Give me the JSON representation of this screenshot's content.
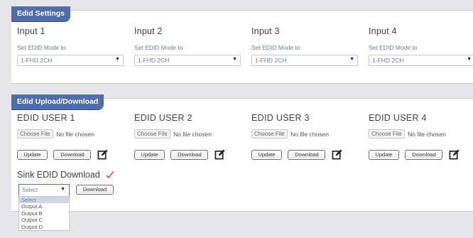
{
  "edid_settings": {
    "tab_label": "Edid Settings",
    "mode_label": "Set EDID Mode to",
    "inputs": [
      {
        "title": "Input 1",
        "selected": "1-FHD 2CH"
      },
      {
        "title": "Input 2",
        "selected": "1-FHD 2CH"
      },
      {
        "title": "Input 3",
        "selected": "1-FHD 2CH"
      },
      {
        "title": "Input 4",
        "selected": "1-FHD 2CH"
      }
    ]
  },
  "edid_upload": {
    "tab_label": "Edid Upload/Download",
    "choose_label": "Choose File",
    "no_file_label": "No file chosen",
    "update_label": "Update",
    "download_label": "Download",
    "users": [
      {
        "title": "EDID USER 1"
      },
      {
        "title": "EDID USER 2"
      },
      {
        "title": "EDID USER 3"
      },
      {
        "title": "EDID USER 4"
      }
    ],
    "sink": {
      "title": "Sink EDID Download",
      "selected": "Select",
      "download_label": "Download",
      "options": [
        "Select",
        "Output A",
        "Output B",
        "Output C",
        "Output D"
      ]
    }
  },
  "colors": {
    "tab_bg": "#4f6da8",
    "panel_bg": "#ffffff",
    "page_bg": "#e6e6e8",
    "check_mark": "#d9302c"
  },
  "icons": {
    "edit": "edit-icon",
    "select_arrow": "dropdown-arrow-icon",
    "check": "checkmark-icon"
  }
}
